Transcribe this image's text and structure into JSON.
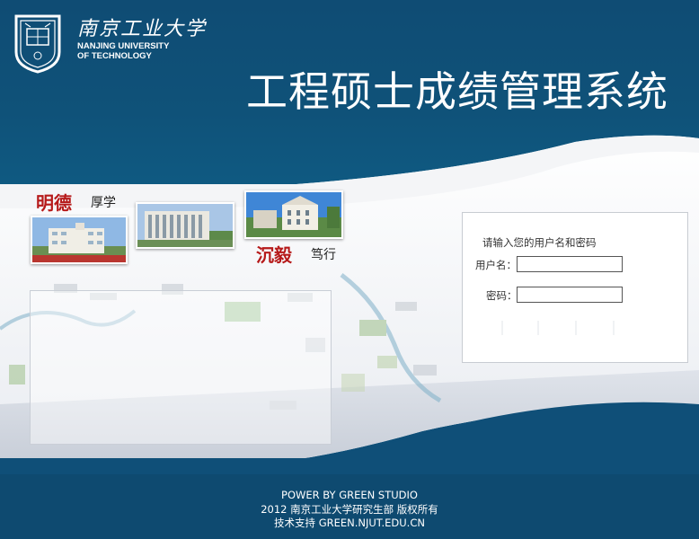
{
  "header": {
    "university_cn": "南京工业大学",
    "university_en_line1": "NANJING UNIVERSITY",
    "university_en_line2": "OF TECHNOLOGY",
    "system_title": "工程硕士成绩管理系统"
  },
  "motto": {
    "word1": "明德",
    "word2": "厚学",
    "word3": "沉毅",
    "word4": "笃行"
  },
  "login": {
    "prompt": "请输入您的用户名和密码",
    "username_label": "用户名：",
    "password_label": "密码：",
    "username_value": "",
    "password_value": ""
  },
  "footer": {
    "line1": "POWER BY GREEN STUDIO",
    "line2": "2012 南京工业大学研究生部 版权所有",
    "line3": "技术支持 GREEN.NJUT.EDU.CN"
  },
  "colors": {
    "brand_blue": "#0f4f78",
    "motto_red": "#b61a1a"
  }
}
